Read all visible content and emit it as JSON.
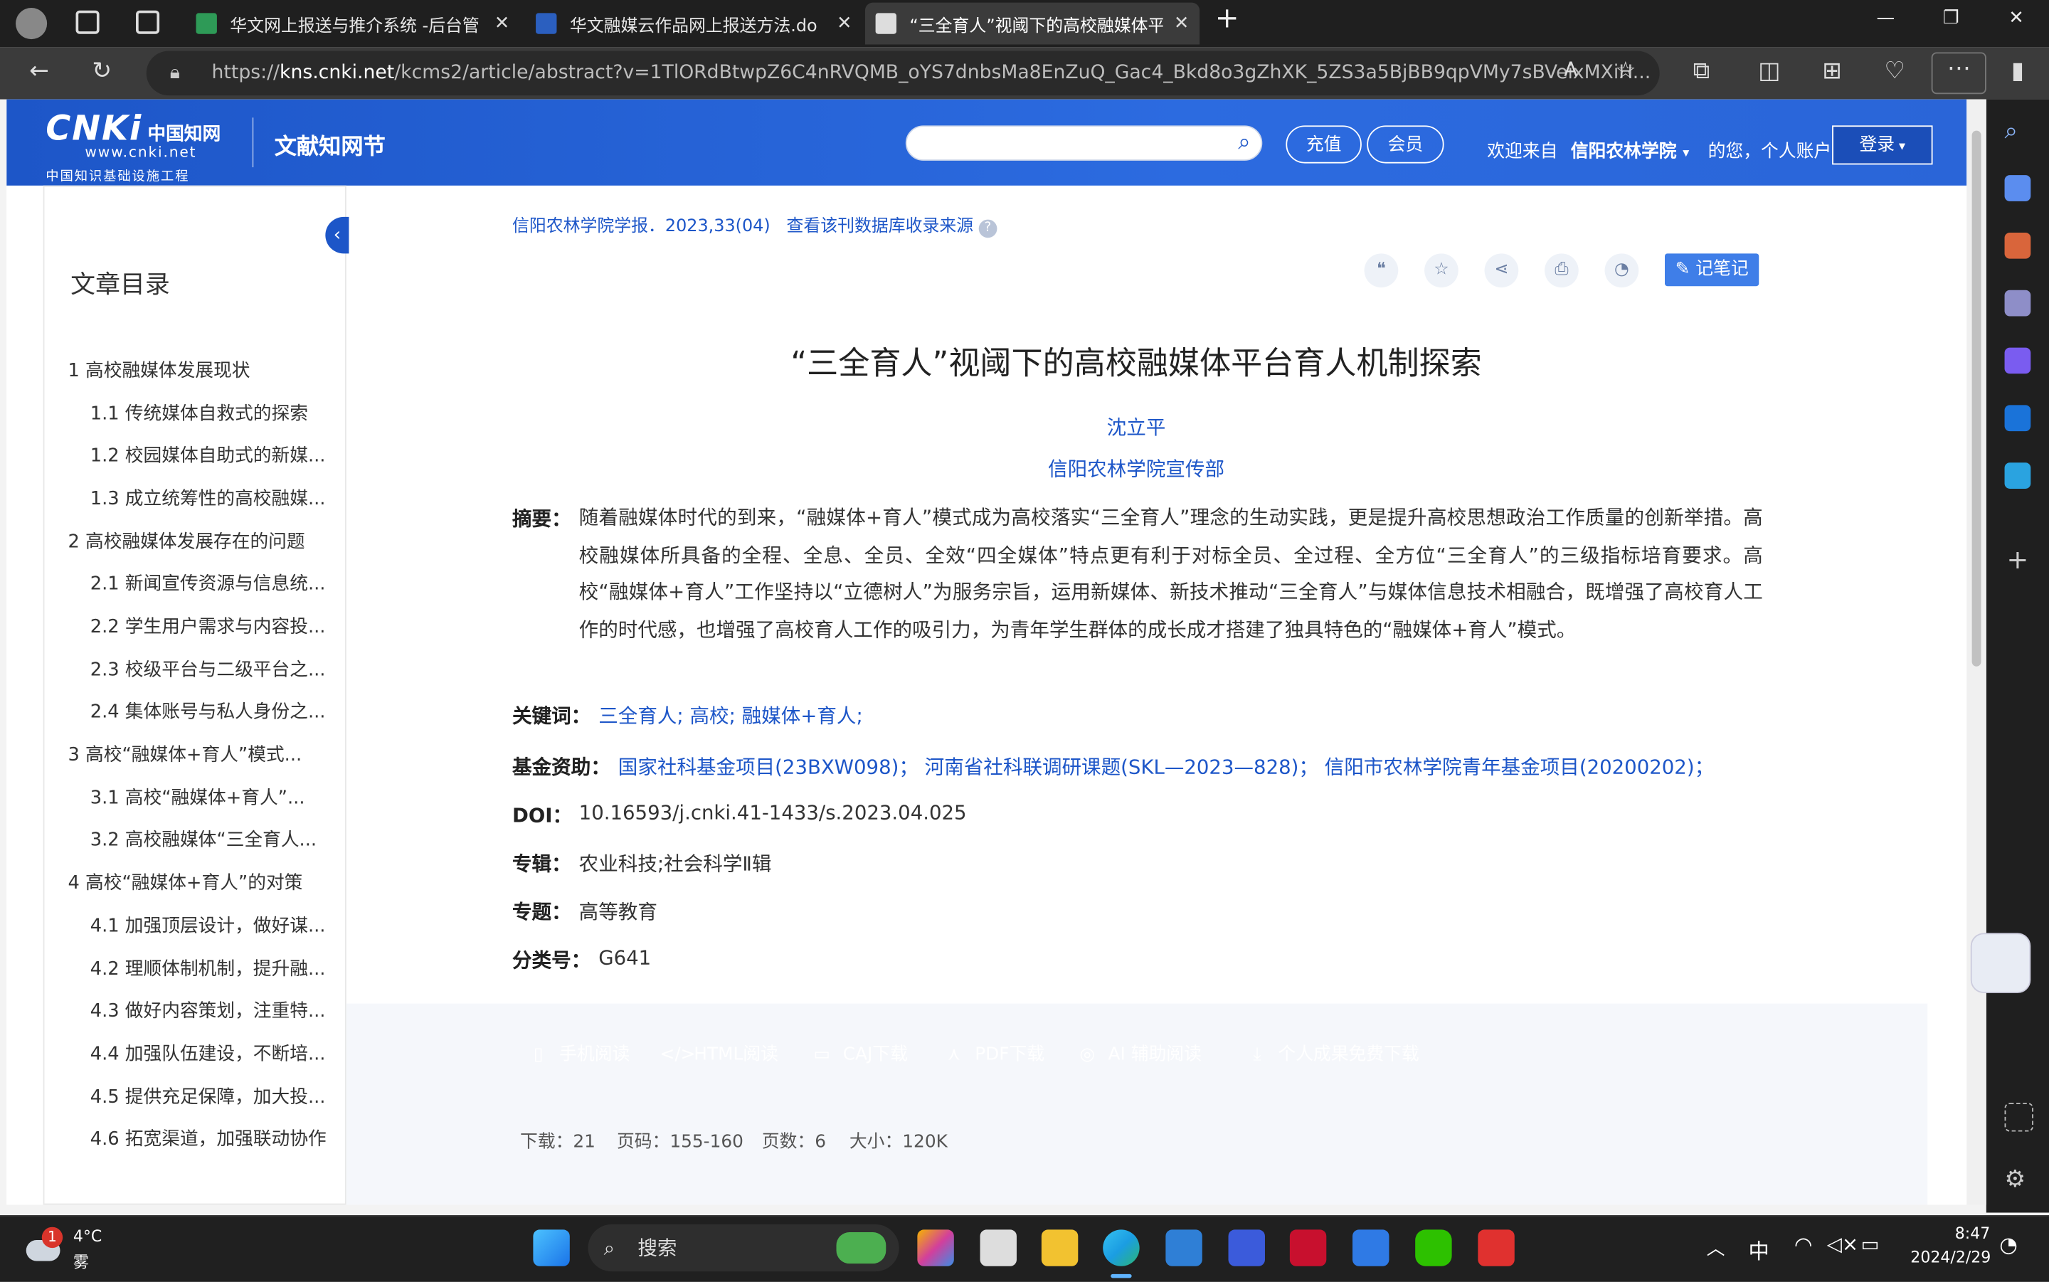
{
  "browser": {
    "tabs": [
      {
        "title": "华文网上报送与推介系统 -后台管"
      },
      {
        "title": "华文融媒云作品网上报送方法.do"
      },
      {
        "title": "“三全育人”视阈下的高校融媒体平"
      }
    ],
    "url_host": "kns.cnki.net",
    "url_rest": "/kcms2/article/abstract?v=1TlORdBtwpZ6C4nRVQMB_oYS7dnbsMa8EnZuQ_Gac4_Bkd8o3gZhXK_5ZS3a5BjBB9qpVMy7sBVeixMXiH...",
    "url_prefix": "https://"
  },
  "header": {
    "logo_big": "CNKi",
    "logo_cn": "中国知网",
    "logo_www": "www.cnki.net",
    "logo_sub": "中国知识基础设施工程",
    "site_name": "文献知网节",
    "recharge": "充值",
    "member": "会员",
    "welcome": "欢迎来自",
    "institution": "信阳农林学院",
    "greeting": "的您，个人账户",
    "login": "登录"
  },
  "toc": {
    "title": "文章目录",
    "items": [
      "1 高校融媒体发展现状",
      "1.1 传统媒体自救式的探索",
      "1.2 校园媒体自助式的新媒...",
      "1.3 成立统筹性的高校融媒...",
      "2 高校融媒体发展存在的问题",
      "2.1 新闻宣传资源与信息统...",
      "2.2 学生用户需求与内容投...",
      "2.3 校级平台与二级平台之...",
      "2.4 集体账号与私人身份之...",
      "3 高校“融媒体+育人”模式...",
      "3.1 高校“融媒体+育人”...",
      "3.2 高校融媒体“三全育人...",
      "4 高校“融媒体+育人”的对策",
      "4.1 加强顶层设计，做好谋...",
      "4.2 理顺体制机制，提升融...",
      "4.3 做好内容策划，注重特...",
      "4.4 加强队伍建设，不断培...",
      "4.5 提供充足保障，加大投...",
      "4.6 拓宽渠道，加强联动协作"
    ]
  },
  "article": {
    "source": "信阳农林学院学报．2023,33(04)",
    "source_link": "查看该刊数据库收录来源",
    "note_button": "记笔记",
    "title": "“三全育人”视阈下的高校融媒体平台育人机制探索",
    "author": "沈立平",
    "organization": "信阳农林学院宣传部",
    "abstract_label": "摘要：",
    "abstract": "随着融媒体时代的到来，“融媒体+育人”模式成为高校落实“三全育人”理念的生动实践，更是提升高校思想政治工作质量的创新举措。高校融媒体所具备的全程、全息、全员、全效“四全媒体”特点更有利于对标全员、全过程、全方位“三全育人”的三级指标培育要求。高校“融媒体+育人”工作坚持以“立德树人”为服务宗旨，运用新媒体、新技术推动“三全育人”与媒体信息技术相融合，既增强了高校育人工作的时代感，也增强了高校育人工作的吸引力，为青年学生群体的成长成才搭建了独具特色的“融媒体+育人”模式。",
    "keywords_label": "关键词：",
    "keywords": "三全育人;  高校;  融媒体+育人;",
    "fund_label": "基金资助：",
    "fund": "国家社科基金项目(23BXW098)；  河南省社科联调研课题(SKL—2023—828)；  信阳市农林学院青年基金项目(20200202)；",
    "doi_label": "DOI：",
    "doi": "10.16593/j.cnki.41-1433/s.2023.04.025",
    "series_label": "专辑：",
    "series": "农业科技;社会科学Ⅱ辑",
    "topic_label": "专题：",
    "topic": "高等教育",
    "class_label": "分类号：",
    "class": "G641"
  },
  "downloads": {
    "buttons": [
      {
        "label": "手机阅读",
        "color": "#4fa9d6"
      },
      {
        "label": "HTML阅读",
        "color": "#f08a4b"
      },
      {
        "label": "CAJ下载",
        "color": "#3f7ee8"
      },
      {
        "label": "PDF下载",
        "color": "#5fb34a"
      },
      {
        "label": "AI 辅助阅读",
        "color": "#3f7ee8"
      },
      {
        "label": "个人成果免费下载",
        "color": "#3f7ee8"
      }
    ],
    "stats": {
      "downloads": "下载：21",
      "pages_range": "页码：155-160",
      "page_count": "页数：6",
      "size": "大小：120K"
    }
  },
  "taskbar": {
    "weather_temp": "4°C",
    "weather_desc": "雾",
    "weather_badge": "1",
    "search": "搜索",
    "ime": "中",
    "time": "8:47",
    "date": "2024/2/29"
  }
}
